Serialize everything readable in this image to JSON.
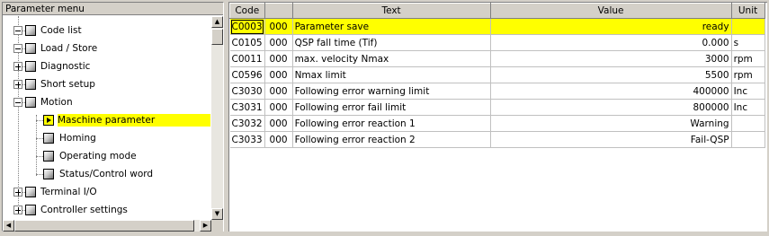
{
  "tree_panel": {
    "title": "Parameter menu",
    "items": [
      {
        "label": "Code list",
        "expander": "minus",
        "icon": "folder"
      },
      {
        "label": "Load / Store",
        "expander": "minus",
        "icon": "folder"
      },
      {
        "label": "Diagnostic",
        "expander": "plus",
        "icon": "folder"
      },
      {
        "label": "Short setup",
        "expander": "plus",
        "icon": "folder"
      },
      {
        "label": "Motion",
        "expander": "minus",
        "icon": "folder"
      },
      {
        "label": "Maschine parameter",
        "icon": "active-page",
        "selected": true
      },
      {
        "label": "Homing",
        "icon": "page"
      },
      {
        "label": "Operating mode",
        "icon": "page"
      },
      {
        "label": "Status/Control word",
        "icon": "page"
      },
      {
        "label": "Terminal I/O",
        "expander": "plus",
        "icon": "folder"
      },
      {
        "label": "Controller settings",
        "expander": "plus",
        "icon": "folder"
      }
    ],
    "selection_color": "#ffff00"
  },
  "grid": {
    "columns": [
      "Code",
      "",
      "Text",
      "Value",
      "Unit"
    ],
    "rows": [
      {
        "code": "C0003",
        "sub": "000",
        "text": "Parameter save",
        "value": "ready",
        "unit": "",
        "selected": true
      },
      {
        "code": "C0105",
        "sub": "000",
        "text": "QSP fall time (Tif)",
        "value": "0.000",
        "unit": "s"
      },
      {
        "code": "C0011",
        "sub": "000",
        "text": "max. velocity Nmax",
        "value": "3000",
        "unit": "rpm"
      },
      {
        "code": "C0596",
        "sub": "000",
        "text": "Nmax limit",
        "value": "5500",
        "unit": "rpm"
      },
      {
        "code": "C3030",
        "sub": "000",
        "text": "Following error warning limit",
        "value": "400000",
        "unit": "Inc"
      },
      {
        "code": "C3031",
        "sub": "000",
        "text": "Following error fail limit",
        "value": "800000",
        "unit": "Inc"
      },
      {
        "code": "C3032",
        "sub": "000",
        "text": "Following error reaction 1",
        "value": "Warning",
        "unit": ""
      },
      {
        "code": "C3033",
        "sub": "000",
        "text": "Following error reaction 2",
        "value": "Fail-QSP",
        "unit": ""
      }
    ]
  }
}
